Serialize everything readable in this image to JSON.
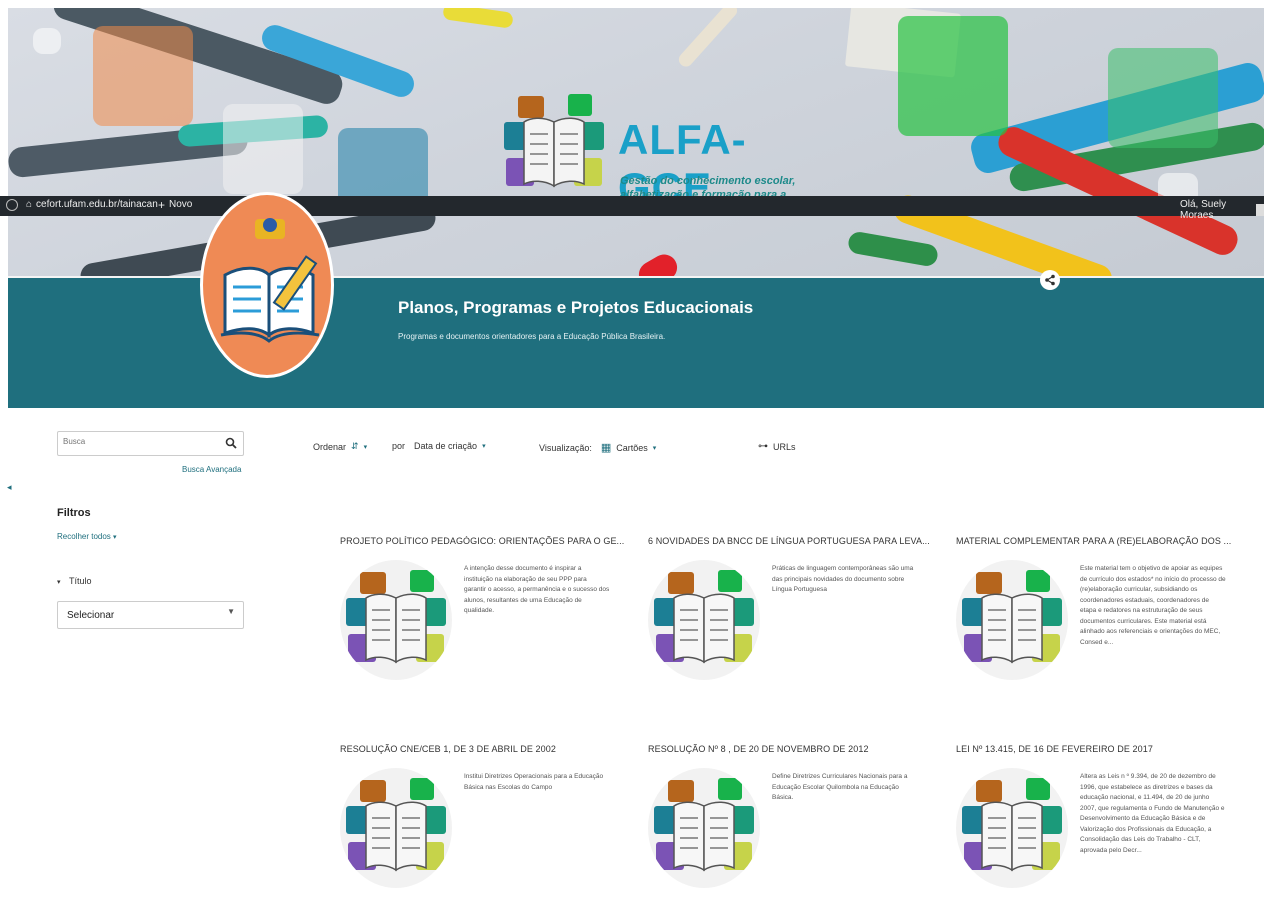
{
  "banner": {
    "logo_title": "ALFA-GCE",
    "logo_subtitle_line1": "Gestão do conhecimento escolar,",
    "logo_subtitle_line2": "alfabetização e formação para a cidadania"
  },
  "admin_bar": {
    "site_url": "cefort.ufam.edu.br/tainacan",
    "new_label": "Novo",
    "greeting": "Olá, Suely Moraes"
  },
  "header": {
    "title": "Planos, Programas e Projetos Educacionais",
    "subtitle": "Programas e documentos orientadores para a Educação Pública Brasileira."
  },
  "sidebar": {
    "search_placeholder": "Busca",
    "advanced_search": "Busca Avançada",
    "filters_title": "Filtros",
    "collapse_all": "Recolher todos",
    "filter_label": "Título",
    "filter_select_value": "Selecionar"
  },
  "toolbar": {
    "sort_label": "Ordenar",
    "by_label": "por",
    "sort_field": "Data de criação",
    "view_label": "Visualização:",
    "view_mode": "Cartões",
    "urls_label": "URLs"
  },
  "cards": [
    {
      "title": "PROJETO POLÍTICO PEDAGÓGICO: ORIENTAÇÕES PARA O GE...",
      "description": "A intenção desse documento é inspirar a instituição na elaboração de seu PPP para garantir o acesso, a permanência e o sucesso dos alunos, resultantes de uma Educação de qualidade."
    },
    {
      "title": "6 NOVIDADES DA BNCC DE LÍNGUA PORTUGUESA PARA LEVA...",
      "description": "Práticas de linguagem contemporâneas são uma das principais novidades do documento sobre Língua Portuguesa"
    },
    {
      "title": "MATERIAL COMPLEMENTAR PARA A (RE)ELABORAÇÃO DOS ...",
      "description": "Este material tem o objetivo de apoiar as equipes de currículo dos estados* no início do processo de (re)elaboração curricular, subsidiando os coordenadores estaduais, coordenadores de etapa e redatores na estruturação de seus documentos curriculares. Este material está alinhado aos referenciais e orientações do MEC, Consed e..."
    },
    {
      "title": "RESOLUÇÃO CNE/CEB 1, DE 3 DE ABRIL DE 2002",
      "description": "Institui Diretrizes Operacionais para a Educação Básica nas Escolas do Campo"
    },
    {
      "title": "RESOLUÇÃO Nº 8 , DE 20 DE NOVEMBRO DE 2012",
      "description": "Define Diretrizes Curriculares Nacionais para a Educação Escolar Quilombola na Educação Básica."
    },
    {
      "title": "LEI Nº 13.415, DE 16 DE FEVEREIRO DE 2017",
      "description": "Altera as Leis n º 9.394, de 20 de dezembro de 1996, que estabelece as diretrizes e bases da educação nacional, e 11.494, de 20 de junho 2007, que regulamenta o Fundo de Manutenção e Desenvolvimento da Educação Básica e de Valorização dos Profissionais da Educação, a Consolidação das Leis do Trabalho - CLT, aprovada pelo Decr..."
    }
  ],
  "colors": {
    "teal": "#1f6f7e",
    "logo_blue": "#1aa0c8",
    "avatar_orange": "#ef8a55",
    "adminbar": "#23282d"
  }
}
